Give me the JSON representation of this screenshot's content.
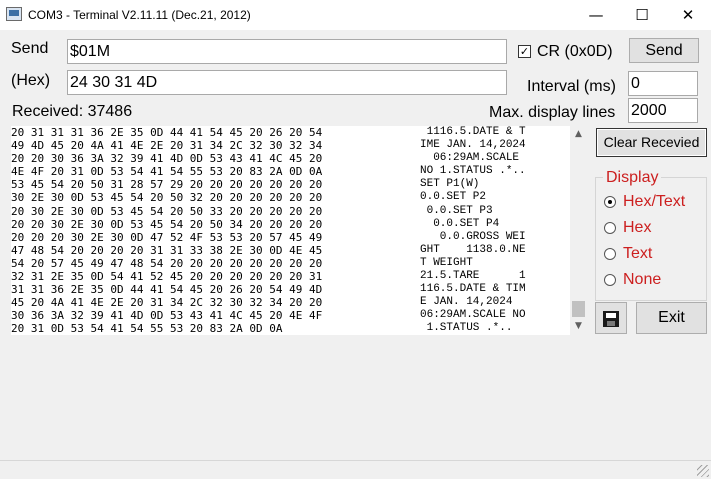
{
  "window": {
    "title": "COM3 - Terminal V2.11.11 (Dec.21, 2012)",
    "minimize_glyph": "—",
    "maximize_glyph": "☐",
    "close_glyph": "✕"
  },
  "send": {
    "label": "Send",
    "value": "$01M",
    "button": "Send"
  },
  "hex": {
    "label": "(Hex)",
    "value": "24 30 31 4D"
  },
  "cr": {
    "label": "CR (0x0D)",
    "checked": true,
    "check_glyph": "✓"
  },
  "interval": {
    "label": "Interval (ms)",
    "value": "0"
  },
  "received": {
    "label": "Received: 37486"
  },
  "max_display": {
    "label": "Max. display lines",
    "value": "2000"
  },
  "terminal": {
    "hex_lines": [
      "20 31 31 31 36 2E 35 0D 44 41 54 45 20 26 20 54",
      "49 4D 45 20 4A 41 4E 2E 20 31 34 2C 32 30 32 34",
      "20 20 30 36 3A 32 39 41 4D 0D 53 43 41 4C 45 20",
      "4E 4F 20 31 0D 53 54 41 54 55 53 20 83 2A 0D 0A",
      "53 45 54 20 50 31 28 57 29 20 20 20 20 20 20 20",
      "30 2E 30 0D 53 45 54 20 50 32 20 20 20 20 20 20",
      "20 30 2E 30 0D 53 45 54 20 50 33 20 20 20 20 20",
      "20 20 30 2E 30 0D 53 45 54 20 50 34 20 20 20 20",
      "20 20 20 30 2E 30 0D 47 52 4F 53 53 20 57 45 49",
      "47 48 54 20 20 20 20 31 31 33 38 2E 30 0D 4E 45",
      "54 20 57 45 49 47 48 54 20 20 20 20 20 20 20 20",
      "32 31 2E 35 0D 54 41 52 45 20 20 20 20 20 20 31",
      "31 31 36 2E 35 0D 44 41 54 45 20 26 20 54 49 4D",
      "45 20 4A 41 4E 2E 20 31 34 2C 32 30 32 34 20 20",
      "30 36 3A 32 39 41 4D 0D 53 43 41 4C 45 20 4E 4F",
      "20 31 0D 53 54 41 54 55 53 20 83 2A 0D 0A"
    ],
    "text_lines": [
      " 1116.5.DATE & T",
      "IME JAN. 14,2024",
      "  06:29AM.SCALE ",
      "NO 1.STATUS .*..",
      "SET P1(W)       ",
      "0.0.SET P2      ",
      " 0.0.SET P3     ",
      "  0.0.SET P4    ",
      "   0.0.GROSS WEI",
      "GHT    1138.0.NE",
      "T WEIGHT        ",
      "21.5.TARE      1",
      "116.5.DATE & TIM",
      "E JAN. 14,2024  ",
      "06:29AM.SCALE NO",
      " 1.STATUS .*.."
    ],
    "scroll_up_glyph": "▲",
    "scroll_down_glyph": "▼"
  },
  "buttons": {
    "clear": "Clear Recevied",
    "exit": "Exit"
  },
  "display": {
    "title": "Display",
    "options": [
      {
        "label": "Hex/Text",
        "selected": true
      },
      {
        "label": "Hex",
        "selected": false
      },
      {
        "label": "Text",
        "selected": false
      },
      {
        "label": "None",
        "selected": false
      }
    ]
  },
  "icons": {
    "app": "terminal-app-icon",
    "save": "floppy-disk-icon",
    "grip": "resize-grip-icon"
  },
  "colors": {
    "display_group_text": "#cc1f1f",
    "background": "#f0f0f0"
  }
}
